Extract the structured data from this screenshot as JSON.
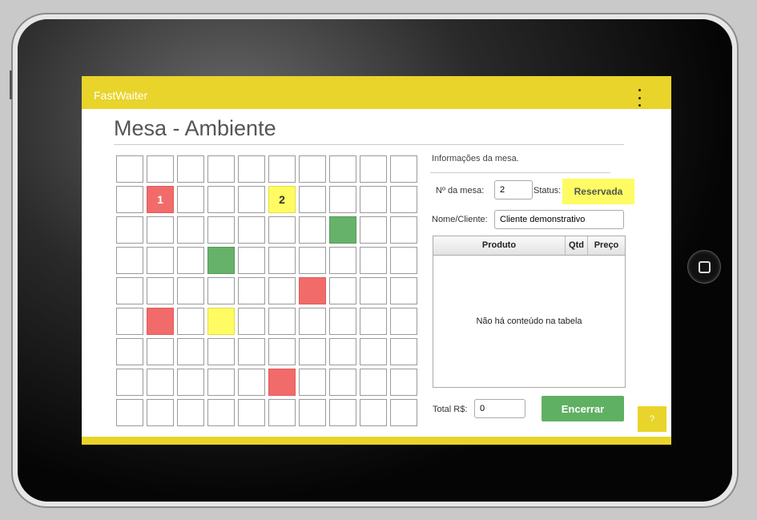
{
  "app": {
    "title": "FastWaiter"
  },
  "page": {
    "title": "Mesa - Ambiente"
  },
  "grid": {
    "cols": 10,
    "rows": 9,
    "tables": [
      {
        "row": 1,
        "col": 1,
        "status": "red",
        "label": "1"
      },
      {
        "row": 1,
        "col": 5,
        "status": "yellow",
        "label": "2"
      },
      {
        "row": 2,
        "col": 7,
        "status": "green",
        "label": ""
      },
      {
        "row": 3,
        "col": 3,
        "status": "green",
        "label": ""
      },
      {
        "row": 4,
        "col": 6,
        "status": "red",
        "label": ""
      },
      {
        "row": 5,
        "col": 1,
        "status": "red",
        "label": ""
      },
      {
        "row": 5,
        "col": 3,
        "status": "yellow",
        "label": ""
      },
      {
        "row": 7,
        "col": 5,
        "status": "red",
        "label": ""
      }
    ]
  },
  "panel": {
    "caption": "Informações da mesa.",
    "table_number_label": "Nº da mesa:",
    "table_number_value": "2",
    "status_label": "Status:",
    "status_value": "Reservada",
    "customer_label": "Nome/Cliente:",
    "customer_value": "Cliente demonstrativo",
    "columns": [
      "Produto",
      "Qtd",
      "Preço"
    ],
    "empty_message": "Não há conteúdo na tabela",
    "total_label": "Total R$:",
    "total_value": "0",
    "close_button": "Encerrar",
    "help_button": "?"
  },
  "colors": {
    "accent": "#e8d42a",
    "red": "#f26b6b",
    "yellow": "#fffb63",
    "green": "#66b26a"
  }
}
